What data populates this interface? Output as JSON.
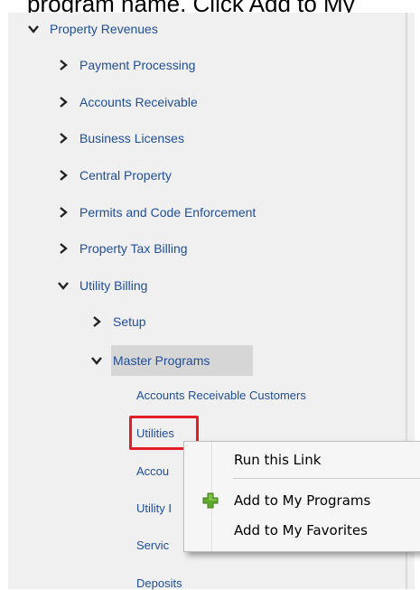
{
  "instruction_text": "program name. Click Add to My",
  "tree": {
    "root": "Property Revenues",
    "children": [
      "Payment Processing",
      "Accounts Receivable",
      "Business Licenses",
      "Central Property",
      "Permits and Code Enforcement",
      "Property Tax Billing",
      "Utility Billing"
    ],
    "utility_children": [
      "Setup",
      "Master Programs"
    ],
    "master_programs_items": [
      "Accounts Receivable Customers",
      "Utilities",
      "Accou",
      "Utility I",
      "Servic",
      "Deposits"
    ]
  },
  "context_menu": {
    "items": [
      "Run this Link",
      "Add to My Programs",
      "Add to My Favorites"
    ]
  },
  "colors": {
    "link": "#1f4e9a",
    "highlight_border": "#e21f26",
    "selection": "#d6d6d6",
    "panel": "#f0f0f0"
  },
  "icons": {
    "expanded": "chevron-down-icon",
    "collapsed": "chevron-right-icon",
    "add": "green-plus-icon"
  }
}
